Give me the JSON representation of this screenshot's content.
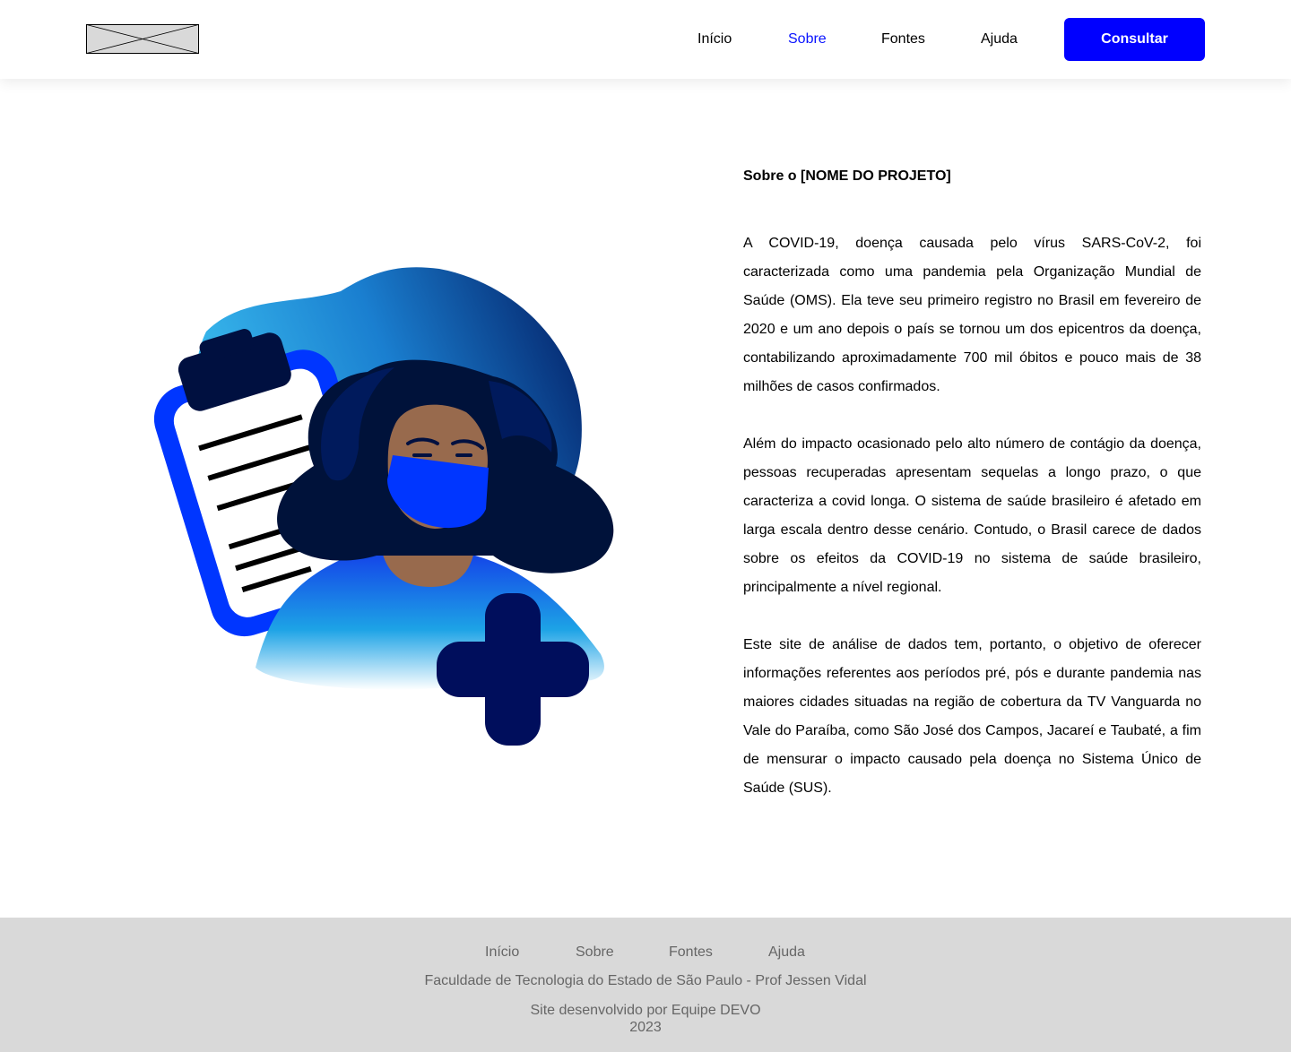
{
  "header": {
    "logo_alt": "",
    "nav": [
      {
        "label": "Início",
        "active": false
      },
      {
        "label": "Sobre",
        "active": true
      },
      {
        "label": "Fontes",
        "active": false
      },
      {
        "label": "Ajuda",
        "active": false
      }
    ],
    "cta_label": "Consultar"
  },
  "colors": {
    "accent": "#0000ff",
    "active_link": "#0a14ff",
    "footer_bg": "#d9d9d9",
    "footer_text": "#666666"
  },
  "main": {
    "title": "Sobre o [NOME DO PROJETO]",
    "paragraphs": [
      "A COVID-19, doença causada pelo vírus SARS-CoV-2, foi caracterizada como uma pandemia pela Organização Mundial de Saúde (OMS). Ela teve seu primeiro registro no Brasil em fevereiro de 2020 e um ano depois o país se tornou um dos epicentros da doença, contabilizando aproximadamente 700 mil óbitos e pouco mais de 38 milhões de casos confirmados.",
      "Além do impacto ocasionado pelo alto número de contágio da doença, pessoas recuperadas apresentam sequelas a longo prazo, o que caracteriza a covid longa. O sistema de saúde brasileiro é afetado em larga escala dentro desse cenário. Contudo, o Brasil carece de dados sobre os efeitos da COVID-19 no sistema de saúde brasileiro, principalmente a nível regional.",
      "Este site de análise de dados tem, portanto, o objetivo de oferecer informações referentes aos períodos pré, pós e durante pandemia nas maiores cidades situadas na região de cobertura da TV Vanguarda no Vale do Paraíba, como São José dos Campos, Jacareí e Taubaté, a fim de mensurar o impacto causado pela doença no Sistema Único de Saúde (SUS)."
    ]
  },
  "footer": {
    "nav": [
      {
        "label": "Início"
      },
      {
        "label": "Sobre"
      },
      {
        "label": "Fontes"
      },
      {
        "label": "Ajuda"
      }
    ],
    "institution": "Faculdade de Tecnologia do Estado de São Paulo - Prof Jessen Vidal",
    "credits": "Site desenvolvido por Equipe DEVO",
    "year": "2023"
  }
}
